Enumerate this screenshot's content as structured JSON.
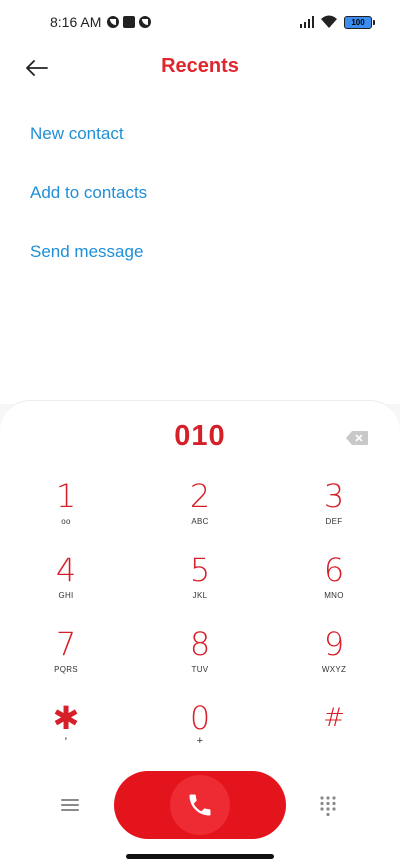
{
  "status_bar": {
    "time": "8:16 AM",
    "battery": "100"
  },
  "header": {
    "title": "Recents"
  },
  "actions": {
    "new_contact": "New contact",
    "add_to_contacts": "Add to contacts",
    "send_message": "Send message"
  },
  "dialer": {
    "number": "010",
    "keys": [
      {
        "digit": "1",
        "letters": "ᴏᴏ"
      },
      {
        "digit": "2",
        "letters": "ABC"
      },
      {
        "digit": "3",
        "letters": "DEF"
      },
      {
        "digit": "4",
        "letters": "GHI"
      },
      {
        "digit": "5",
        "letters": "JKL"
      },
      {
        "digit": "6",
        "letters": "MNO"
      },
      {
        "digit": "7",
        "letters": "PQRS"
      },
      {
        "digit": "8",
        "letters": "TUV"
      },
      {
        "digit": "9",
        "letters": "WXYZ"
      },
      {
        "digit": "✱",
        "letters": "’"
      },
      {
        "digit": "0",
        "letters": "+"
      },
      {
        "digit": "#",
        "letters": ""
      }
    ]
  },
  "colors": {
    "accent": "#e0262d",
    "link": "#1f8fd6",
    "call_button": "#e3141c"
  },
  "icons": {
    "back": "arrow-left-icon",
    "backspace": "backspace-icon",
    "menu": "menu-icon",
    "call": "phone-icon",
    "dialpad": "dialpad-icon"
  }
}
